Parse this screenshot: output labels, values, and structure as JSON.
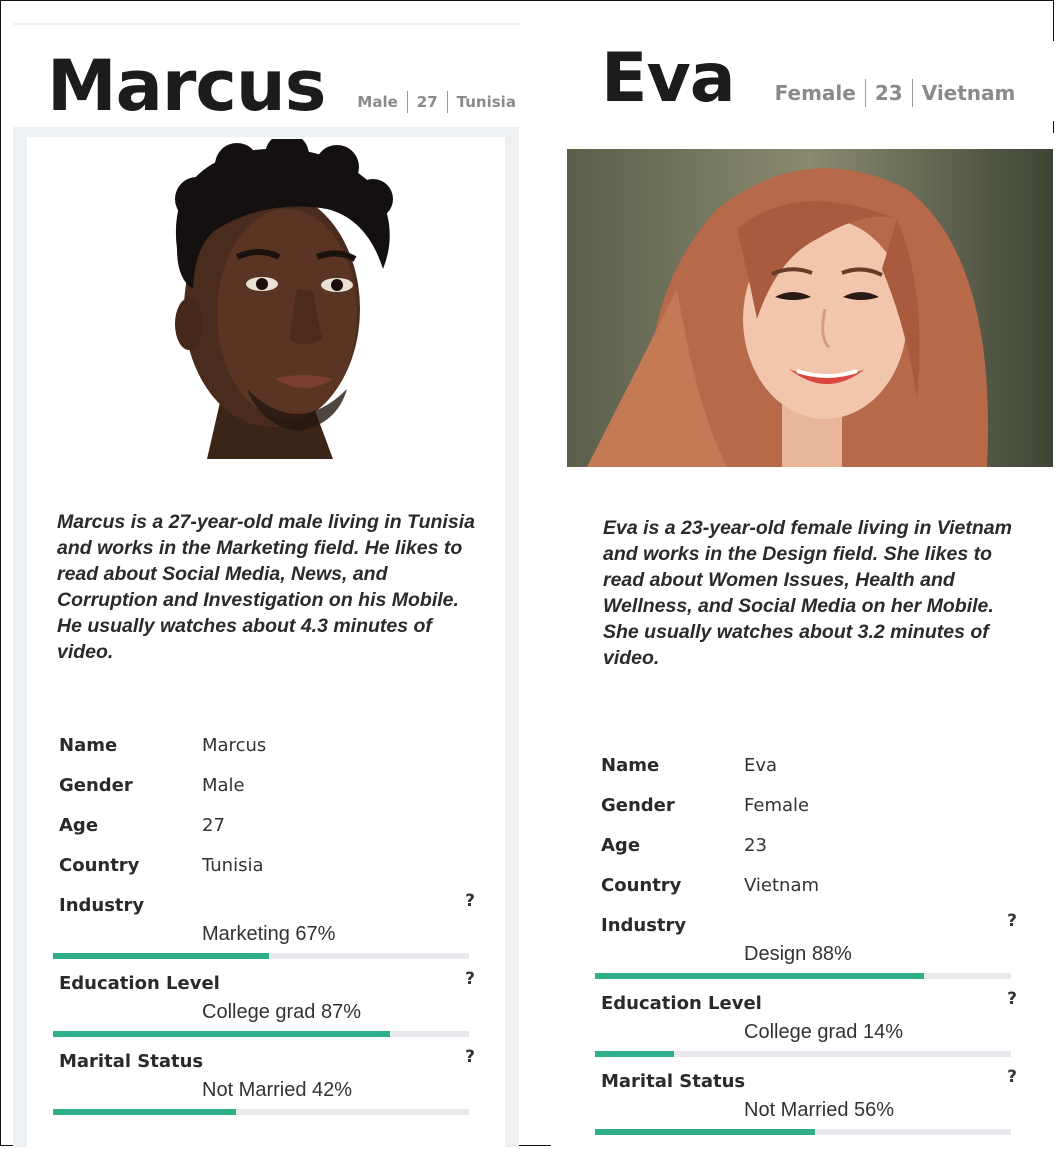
{
  "personas": [
    {
      "name": "Marcus",
      "gender": "Male",
      "age": "27",
      "country": "Tunisia",
      "bio": "Marcus is a 27-year-old male living in Tunisia and works in the Marketing field. He likes to read about Social Media, News, and Corruption and Investigation on his Mobile. He usually watches about 4.3 minutes of video.",
      "facts": [
        {
          "label": "Name",
          "value": "Marcus"
        },
        {
          "label": "Gender",
          "value": "Male"
        },
        {
          "label": "Age",
          "value": "27"
        },
        {
          "label": "Country",
          "value": "Tunisia"
        }
      ],
      "metrics": [
        {
          "label": "Industry",
          "value": "Marketing 67%",
          "percent": 52,
          "help": "?"
        },
        {
          "label": "Education Level",
          "value": "College grad 87%",
          "percent": 81,
          "help": "?"
        },
        {
          "label": "Marital Status",
          "value": "Not Married 42%",
          "percent": 44,
          "help": "?"
        }
      ]
    },
    {
      "name": "Eva",
      "gender": "Female",
      "age": "23",
      "country": "Vietnam",
      "bio": "Eva is a 23-year-old female living in Vietnam and works in the Design field. She likes to read about Women Issues, Health and Wellness, and Social Media on her Mobile. She usually watches about 3.2 minutes of video.",
      "facts": [
        {
          "label": "Name",
          "value": "Eva"
        },
        {
          "label": "Gender",
          "value": "Female"
        },
        {
          "label": "Age",
          "value": "23"
        },
        {
          "label": "Country",
          "value": "Vietnam"
        }
      ],
      "metrics": [
        {
          "label": "Industry",
          "value": "Design 88%",
          "percent": 79,
          "help": "?"
        },
        {
          "label": "Education Level",
          "value": "College grad 14%",
          "percent": 19,
          "help": "?"
        },
        {
          "label": "Marital Status",
          "value": "Not Married 56%",
          "percent": 53,
          "help": "?"
        }
      ]
    }
  ],
  "colors": {
    "bar_fill": "#2fae8a",
    "bar_track": "#e7e9ec",
    "card_border": "#eef1f4"
  }
}
